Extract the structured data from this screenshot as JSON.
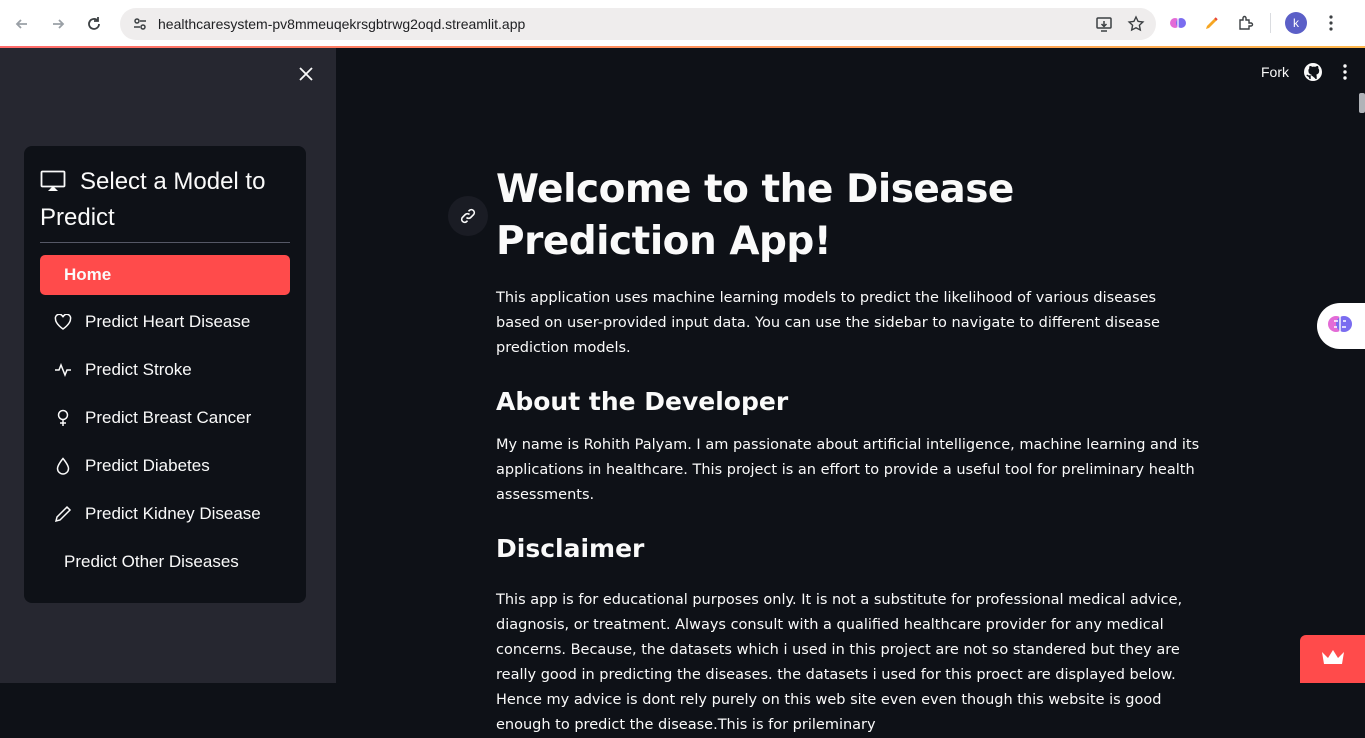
{
  "browser": {
    "url": "healthcaresystem-pv8mmeuqekrsgbtrwg2oqd.streamlit.app",
    "avatar_letter": "k"
  },
  "sidebar": {
    "menu_title": "Select a Model to Predict",
    "items": [
      {
        "label": "Home",
        "icon": "none",
        "active": true
      },
      {
        "label": "Predict Heart Disease",
        "icon": "heart-icon"
      },
      {
        "label": "Predict Stroke",
        "icon": "activity-icon"
      },
      {
        "label": "Predict Breast Cancer",
        "icon": "female-icon"
      },
      {
        "label": "Predict Diabetes",
        "icon": "droplet-icon"
      },
      {
        "label": "Predict Kidney Disease",
        "icon": "pencil-icon"
      },
      {
        "label": "Predict Other Diseases",
        "icon": "none"
      }
    ],
    "accent_color": "#ff4b4b"
  },
  "header": {
    "fork_label": "Fork"
  },
  "main": {
    "title": "Welcome to the Disease Prediction App!",
    "intro": "This application uses machine learning models to predict the likelihood of various diseases based on user-provided input data. You can use the sidebar to navigate to different disease prediction models.",
    "about_heading": "About the Developer",
    "about_text": "My name is Rohith Palyam. I am passionate about artificial intelligence, machine learning and its applications in healthcare. This project is an effort to provide a useful tool for preliminary health assessments.",
    "disclaimer_heading": "Disclaimer",
    "disclaimer_text": "This app is for educational purposes only. It is not a substitute for professional medical advice, diagnosis, or treatment. Always consult with a qualified healthcare provider for any medical concerns. Because, the datasets which i used in this project are not so standered but they are really good in predicting the diseases. the datasets i used for this proect are displayed below. Hence my advice is dont rely purely on this web site even even though this website is good enough to predict the disease.This is for prileminary"
  }
}
